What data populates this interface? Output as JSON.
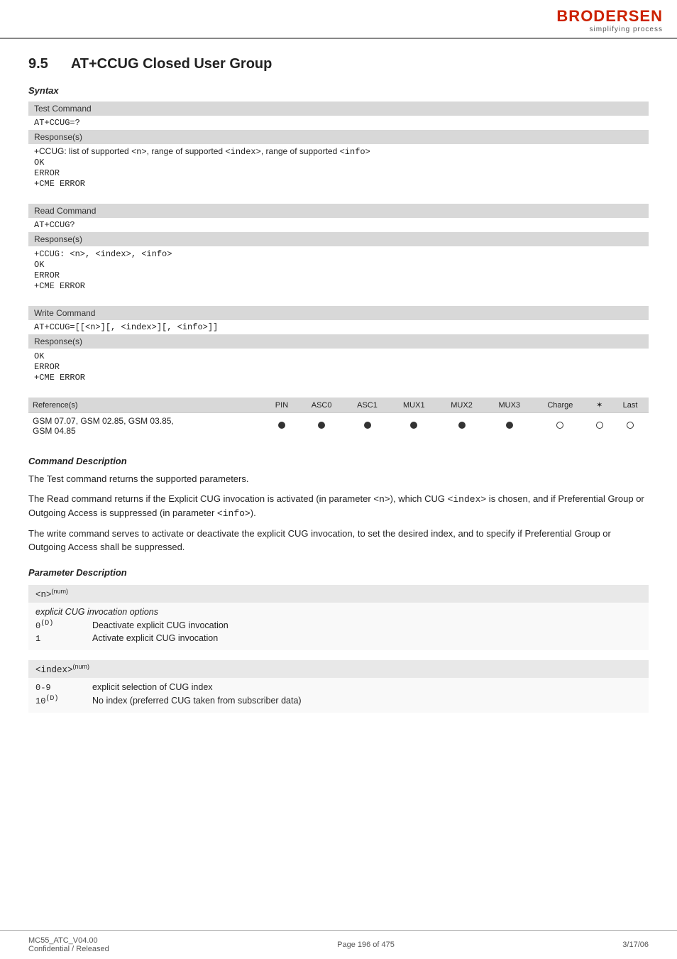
{
  "header": {
    "brand": "BRODERSEN",
    "tagline": "simplifying process"
  },
  "section": {
    "number": "9.5",
    "title": "AT+CCUG   Closed User Group"
  },
  "syntax_label": "Syntax",
  "command_blocks": [
    {
      "type_label": "Test Command",
      "command": "AT+CCUG=?",
      "responses_label": "Response(s)",
      "responses": [
        "+CCUG: list of supported <n>, range of supported <index>, range of supported <info>",
        "OK",
        "ERROR",
        "+CME ERROR"
      ]
    },
    {
      "type_label": "Read Command",
      "command": "AT+CCUG?",
      "responses_label": "Response(s)",
      "responses": [
        "+CCUG: <n>, <index>, <info>",
        "OK",
        "ERROR",
        "+CME ERROR"
      ]
    },
    {
      "type_label": "Write Command",
      "command": "AT+CCUG=[[<n>][, <index>][, <info>]]",
      "responses_label": "Response(s)",
      "responses": [
        "OK",
        "ERROR",
        "+CME ERROR"
      ]
    }
  ],
  "reference_table": {
    "header_label": "Reference(s)",
    "columns": [
      "PIN",
      "ASC0",
      "ASC1",
      "MUX1",
      "MUX2",
      "MUX3",
      "Charge",
      "icon",
      "Last"
    ],
    "row_label": "GSM 07.07, GSM 02.85, GSM 03.85, GSM 04.85",
    "row_values": [
      "filled",
      "filled",
      "filled",
      "filled",
      "filled",
      "filled",
      "empty",
      "empty",
      "empty"
    ]
  },
  "command_description": {
    "label": "Command Description",
    "paragraphs": [
      "The Test command returns the supported parameters.",
      "The Read command returns if the Explicit CUG invocation is activated (in parameter <n>), which CUG <index> is chosen, and if Preferential Group or Outgoing Access is suppressed (in parameter <info>).",
      "The write command serves to activate or deactivate the explicit CUG invocation, to set the desired index, and to specify if Preferential Group or Outgoing Access shall be suppressed."
    ]
  },
  "parameter_description": {
    "label": "Parameter Description",
    "params": [
      {
        "name": "<n>",
        "superscript": "(num)",
        "item_label": "explicit CUG invocation options",
        "values": [
          {
            "val": "0",
            "val_sup": "(D)",
            "desc": "Deactivate explicit CUG invocation"
          },
          {
            "val": "1",
            "val_sup": "",
            "desc": "Activate explicit CUG invocation"
          }
        ]
      },
      {
        "name": "<index>",
        "superscript": "(num)",
        "item_label": "",
        "values": [
          {
            "val": "0-9",
            "val_sup": "",
            "desc": "explicit selection of CUG index"
          },
          {
            "val": "10",
            "val_sup": "(D)",
            "desc": "No index (preferred CUG taken from subscriber data)"
          }
        ]
      }
    ]
  },
  "footer": {
    "left": "MC55_ATC_V04.00",
    "left2": "Confidential / Released",
    "center": "Page 196 of 475",
    "right": "3/17/06"
  }
}
